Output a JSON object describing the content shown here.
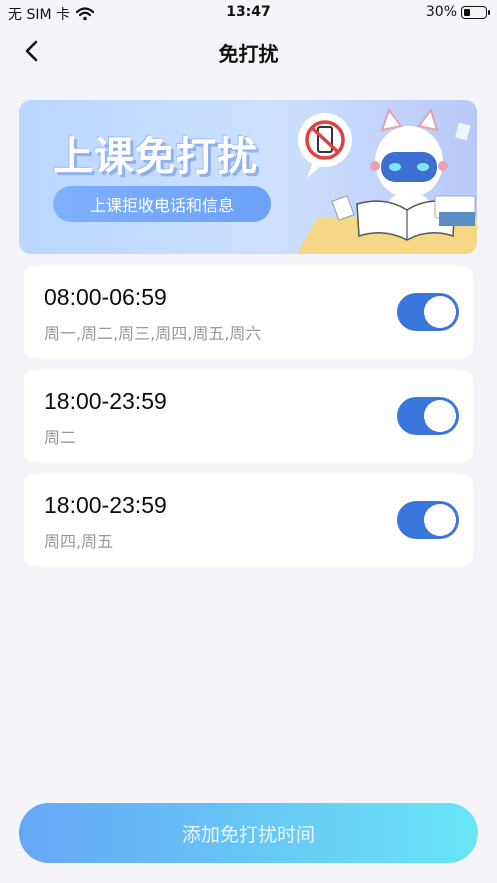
{
  "status_bar": {
    "carrier": "无 SIM 卡",
    "time": "13:47",
    "battery": "30%",
    "battery_level": 0.3
  },
  "nav": {
    "title": "免打扰"
  },
  "banner": {
    "headline": "上课免打扰",
    "subtitle": "上课拒收电话和信息"
  },
  "schedules": [
    {
      "range": "08:00-06:59",
      "days": "周一,周二,周三,周四,周五,周六",
      "enabled": true
    },
    {
      "range": "18:00-23:59",
      "days": "周二",
      "enabled": true
    },
    {
      "range": "18:00-23:59",
      "days": "周四,周五",
      "enabled": true
    }
  ],
  "add_button": {
    "label": "添加免打扰时间"
  },
  "colors": {
    "accent": "#3a77dd",
    "background": "#f4f4f9",
    "button_start": "#66a6f6",
    "button_end": "#68e6f6"
  }
}
